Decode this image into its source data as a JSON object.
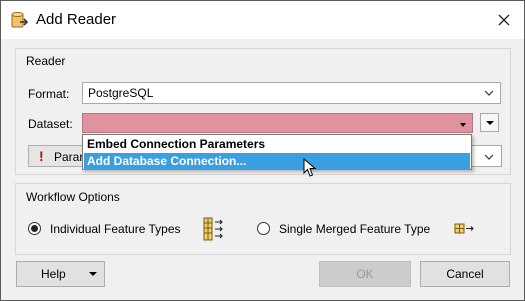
{
  "window": {
    "title": "Add Reader"
  },
  "reader_group": {
    "title": "Reader",
    "format_label": "Format:",
    "format_value": "PostgreSQL",
    "dataset_label": "Dataset:",
    "dataset_value": "",
    "params_button_label": "Parar",
    "dataset_field_color": "#e0939f"
  },
  "dataset_dropdown": {
    "options": [
      {
        "label": "Embed Connection Parameters",
        "selected": false
      },
      {
        "label": "Add Database Connection...",
        "selected": true
      }
    ],
    "highlight_color": "#3a9fe0"
  },
  "workflow_group": {
    "title": "Workflow Options",
    "options": [
      {
        "label": "Individual Feature Types",
        "selected": true,
        "icon": "feature-types-icon"
      },
      {
        "label": "Single Merged Feature Type",
        "selected": false,
        "icon": "merged-feature-type-icon"
      }
    ]
  },
  "buttons": {
    "help": "Help",
    "ok": "OK",
    "cancel": "Cancel"
  }
}
